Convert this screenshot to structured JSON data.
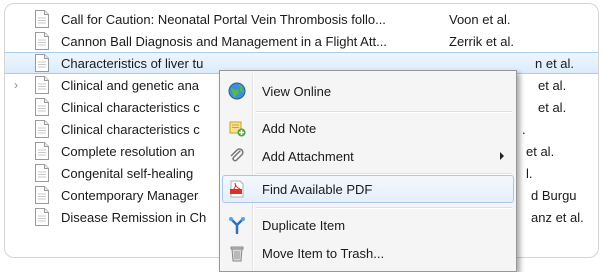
{
  "items": [
    {
      "title": "Call for Caution: Neonatal Portal Vein Thrombosis follo...",
      "creator": "Voon et al."
    },
    {
      "title": "Cannon Ball Diagnosis and Management in a Flight Att...",
      "creator": "Zerrik et al."
    },
    {
      "title": "Characteristics of liver tu",
      "creator": "n et al."
    },
    {
      "title": "Clinical and genetic ana",
      "creator": "et al."
    },
    {
      "title": "Clinical characteristics c",
      "creator": "et al."
    },
    {
      "title": "Clinical characteristics c",
      "creator": "."
    },
    {
      "title": "Complete resolution an",
      "creator": "et al."
    },
    {
      "title": "Congenital self-healing",
      "creator": "l."
    },
    {
      "title": "Contemporary Manager",
      "creator": "d Burgu"
    },
    {
      "title": "Disease Remission in Ch",
      "creator": "anz et al."
    }
  ],
  "selected_index": 2,
  "expandable_index": 3,
  "context_menu": {
    "items": [
      {
        "label": "View Online",
        "icon": "globe-icon"
      },
      {
        "label": "Add Note",
        "icon": "note-add-icon"
      },
      {
        "label": "Add Attachment",
        "icon": "paperclip-icon",
        "submenu": true
      },
      {
        "label": "Find Available PDF",
        "icon": "pdf-icon",
        "highlighted": true
      },
      {
        "label": "Duplicate Item",
        "icon": "duplicate-icon"
      },
      {
        "label": "Move Item to Trash...",
        "icon": "trash-icon"
      }
    ]
  }
}
